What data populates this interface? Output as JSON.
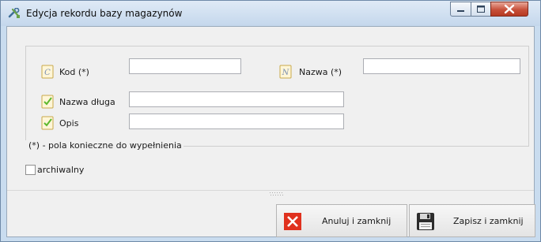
{
  "window": {
    "title": "Edycja rekordu bazy magazynów",
    "app_icon": "tools-icon"
  },
  "form": {
    "kod_label": "Kod (*)",
    "kod_value": "",
    "nazwa_label": "Nazwa (*)",
    "nazwa_value": "",
    "nazwa_dluga_label": "Nazwa długa",
    "nazwa_dluga_value": "",
    "opis_label": "Opis",
    "opis_value": "",
    "required_note": "(*) - pola konieczne do wypełnienia"
  },
  "archival": {
    "label": "archiwalny",
    "checked": false
  },
  "buttons": {
    "cancel_label": "Anuluj i zamknij",
    "save_label": "Zapisz i zamknij"
  },
  "colors": {
    "cancel_icon": "#e0311e",
    "check_icon": "#5cb82e",
    "title_bar": "#c9dcef"
  }
}
